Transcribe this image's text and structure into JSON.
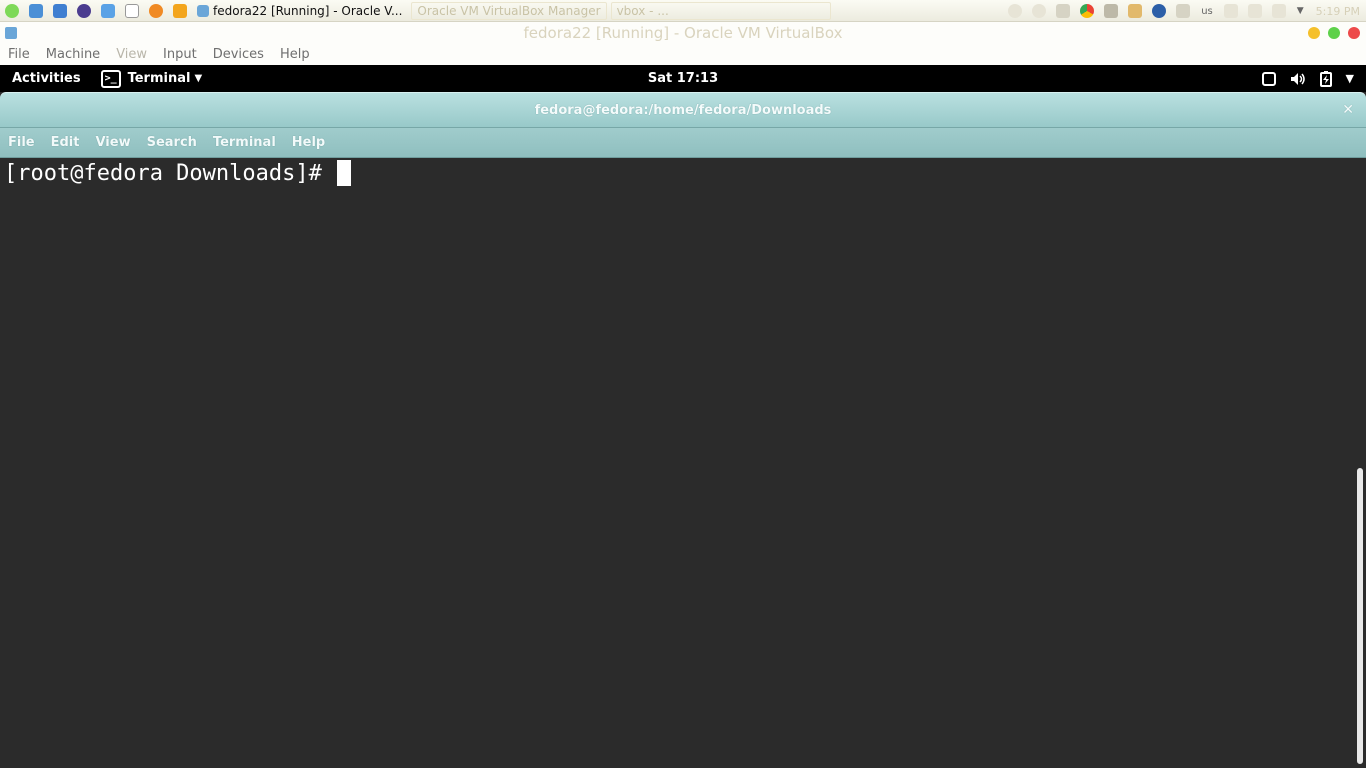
{
  "host_taskbar": {
    "tasks": {
      "active": "fedora22 [Running] - Oracle V...",
      "vbox_manager": "Oracle VM VirtualBox Manager",
      "vbox_other": "vbox - ..."
    },
    "tray_text": "us",
    "clock": "5:19 PM"
  },
  "vbox": {
    "title": "fedora22 [Running] - Oracle VM VirtualBox",
    "menu": [
      "File",
      "Machine",
      "View",
      "Input",
      "Devices",
      "Help"
    ]
  },
  "gnome": {
    "activities": "Activities",
    "app_menu": "Terminal",
    "clock": "Sat 17:13"
  },
  "terminal": {
    "title": "fedora@fedora:/home/fedora/Downloads",
    "menu": [
      "File",
      "Edit",
      "View",
      "Search",
      "Terminal",
      "Help"
    ],
    "prompt": "[root@fedora Downloads]# "
  },
  "colors": {
    "terminal_bg": "#2b2b2b",
    "header_teal": "#98c9c9",
    "gnome_bar": "#000000"
  }
}
